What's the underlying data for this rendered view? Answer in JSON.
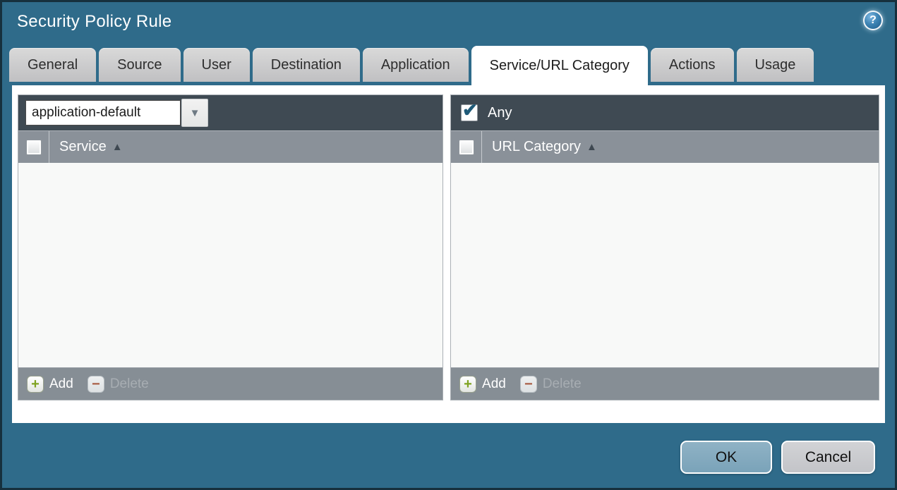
{
  "window": {
    "title": "Security Policy Rule"
  },
  "icons": {
    "help": "?",
    "dropdown_arrow": "▼",
    "sort_asc": "▲",
    "add_plus": "+",
    "delete_minus": "−",
    "check": "✔"
  },
  "tabs": [
    {
      "label": "General",
      "active": false
    },
    {
      "label": "Source",
      "active": false
    },
    {
      "label": "User",
      "active": false
    },
    {
      "label": "Destination",
      "active": false
    },
    {
      "label": "Application",
      "active": false
    },
    {
      "label": "Service/URL Category",
      "active": true
    },
    {
      "label": "Actions",
      "active": false
    },
    {
      "label": "Usage",
      "active": false
    }
  ],
  "service_panel": {
    "dropdown_value": "application-default",
    "column_header": "Service",
    "select_all_checked": false,
    "rows": [],
    "add_label": "Add",
    "delete_label": "Delete",
    "delete_enabled": false
  },
  "url_panel": {
    "any_label": "Any",
    "any_checked": true,
    "column_header": "URL Category",
    "select_all_checked": false,
    "rows": [],
    "add_label": "Add",
    "delete_label": "Delete",
    "delete_enabled": false
  },
  "footer_buttons": {
    "ok": "OK",
    "cancel": "Cancel"
  },
  "colors": {
    "dialog_background": "#2F6B8A",
    "dialog_border": "#16303d",
    "panel_top_bar": "#3F4A53",
    "panel_header": "#8A9199",
    "panel_footer": "#868E95",
    "panel_body": "#F8F9F8",
    "active_tab": "#ffffff",
    "inactive_tab": "#c8c8c8",
    "ok_button": "#7FA8BD",
    "cancel_button": "#C9CACE",
    "add_plus_green": "#7FA321",
    "delete_minus_red": "#A85C42",
    "checkmark_blue": "#1E5A78"
  }
}
